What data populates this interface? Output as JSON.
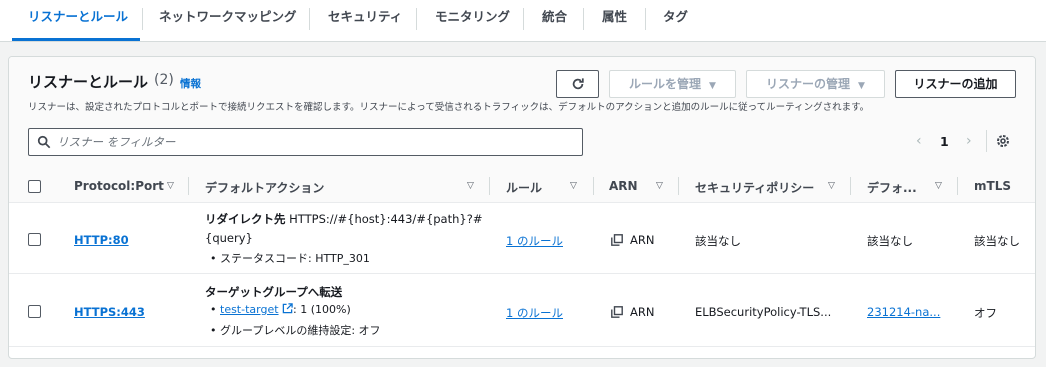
{
  "tabs": [
    {
      "label": "リスナーとルール",
      "active": true
    },
    {
      "label": "ネットワークマッピング"
    },
    {
      "label": "セキュリティ"
    },
    {
      "label": "モニタリング"
    },
    {
      "label": "統合"
    },
    {
      "label": "属性"
    },
    {
      "label": "タグ"
    }
  ],
  "panel": {
    "title": "リスナーとルール",
    "count": "(2)",
    "info": "情報",
    "description": "リスナーは、設定されたプロトコルとポートで接続リクエストを確認します。リスナーによって受信されるトラフィックは、デフォルトのアクションと追加のルールに従ってルーティングされます。",
    "buttons": {
      "manage_rules": "ルールを管理",
      "manage_listener": "リスナーの管理",
      "add_listener": "リスナーの追加"
    },
    "search_placeholder": "リスナー をフィルター",
    "page": "1"
  },
  "columns": [
    "Protocol:Port",
    "デフォルトアクション",
    "ルール",
    "ARN",
    "セキュリティポリシー",
    "デフォ...",
    "mTLS"
  ],
  "rows": [
    {
      "protocol_port": "HTTP:80",
      "action_title": "リダイレクト先",
      "action_target_line1": "HTTPS://#{host}:443/#{path}?#",
      "action_target_line2": "{query}",
      "action_detail": "ステータスコード: HTTP_301",
      "rules": "1 のルール",
      "arn": "ARN",
      "security_policy": "該当なし",
      "default_cert": "該当なし",
      "mtls": "該当なし"
    },
    {
      "protocol_port": "HTTPS:443",
      "action_title": "ターゲットグループへ転送",
      "target_group": "test-target",
      "target_weight": ": 1 (100%)",
      "stickiness": "グループレベルの維持設定: オフ",
      "rules": "1 のルール",
      "arn": "ARN",
      "security_policy": "ELBSecurityPolicy-TLS...",
      "default_cert": "231214-na...",
      "mtls": "オフ"
    }
  ],
  "colors": {
    "accent": "#0972d3",
    "text": "#16191f",
    "border": "#d5dbdb"
  },
  "icons": [
    "refresh-icon",
    "caret-down-icon",
    "search-icon",
    "chevron-left-icon",
    "chevron-right-icon",
    "gear-icon",
    "sort-icon",
    "copy-icon",
    "external-link-icon"
  ]
}
